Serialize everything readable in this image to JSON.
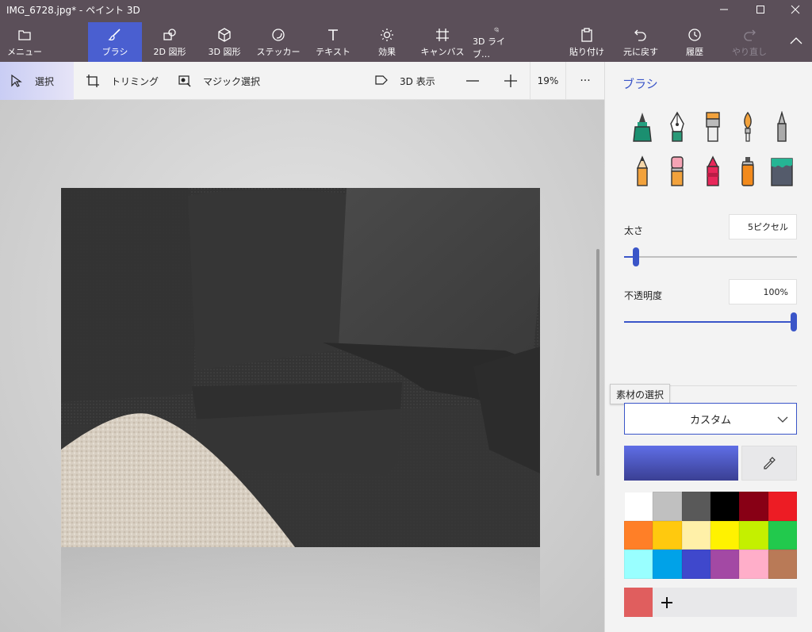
{
  "window": {
    "title": "IMG_6728.jpg* - ペイント 3D"
  },
  "toolbar": {
    "menu": "メニュー",
    "tools": [
      {
        "label": "ブラシ"
      },
      {
        "label": "2D 図形"
      },
      {
        "label": "3D 図形"
      },
      {
        "label": "ステッカー"
      },
      {
        "label": "テキスト"
      },
      {
        "label": "効果"
      },
      {
        "label": "キャンバス"
      },
      {
        "label": "3D ライブ…"
      }
    ],
    "paste": "貼り付け",
    "undo": "元に戻す",
    "history": "履歴",
    "redo": "やり直し"
  },
  "subbar": {
    "select": "選択",
    "crop": "トリミング",
    "magic_select": "マジック選択",
    "view_3d": "3D 表示",
    "zoom_level": "19%",
    "more": "···"
  },
  "panel": {
    "title": "ブラシ",
    "thickness_label": "太さ",
    "thickness_value": "5ピクセル",
    "thickness_level": 0.05,
    "opacity_label": "不透明度",
    "opacity_value": "100%",
    "opacity_level": 1.0,
    "tooltip": "素材の選択",
    "material_value": "カスタム",
    "current_color": "#4a55c8",
    "custom_color": "#e05e5e",
    "palette": [
      "#ffffff",
      "#c0c0c0",
      "#595959",
      "#000000",
      "#880015",
      "#ed1c24",
      "#ff7f27",
      "#ffc90e",
      "#fff0a8",
      "#fff200",
      "#c4f000",
      "#22c94d",
      "#99ffff",
      "#00a2e8",
      "#3f48cc",
      "#a349a4",
      "#ffaec9",
      "#b97a57"
    ]
  },
  "accent_color": "#4a5fd0"
}
